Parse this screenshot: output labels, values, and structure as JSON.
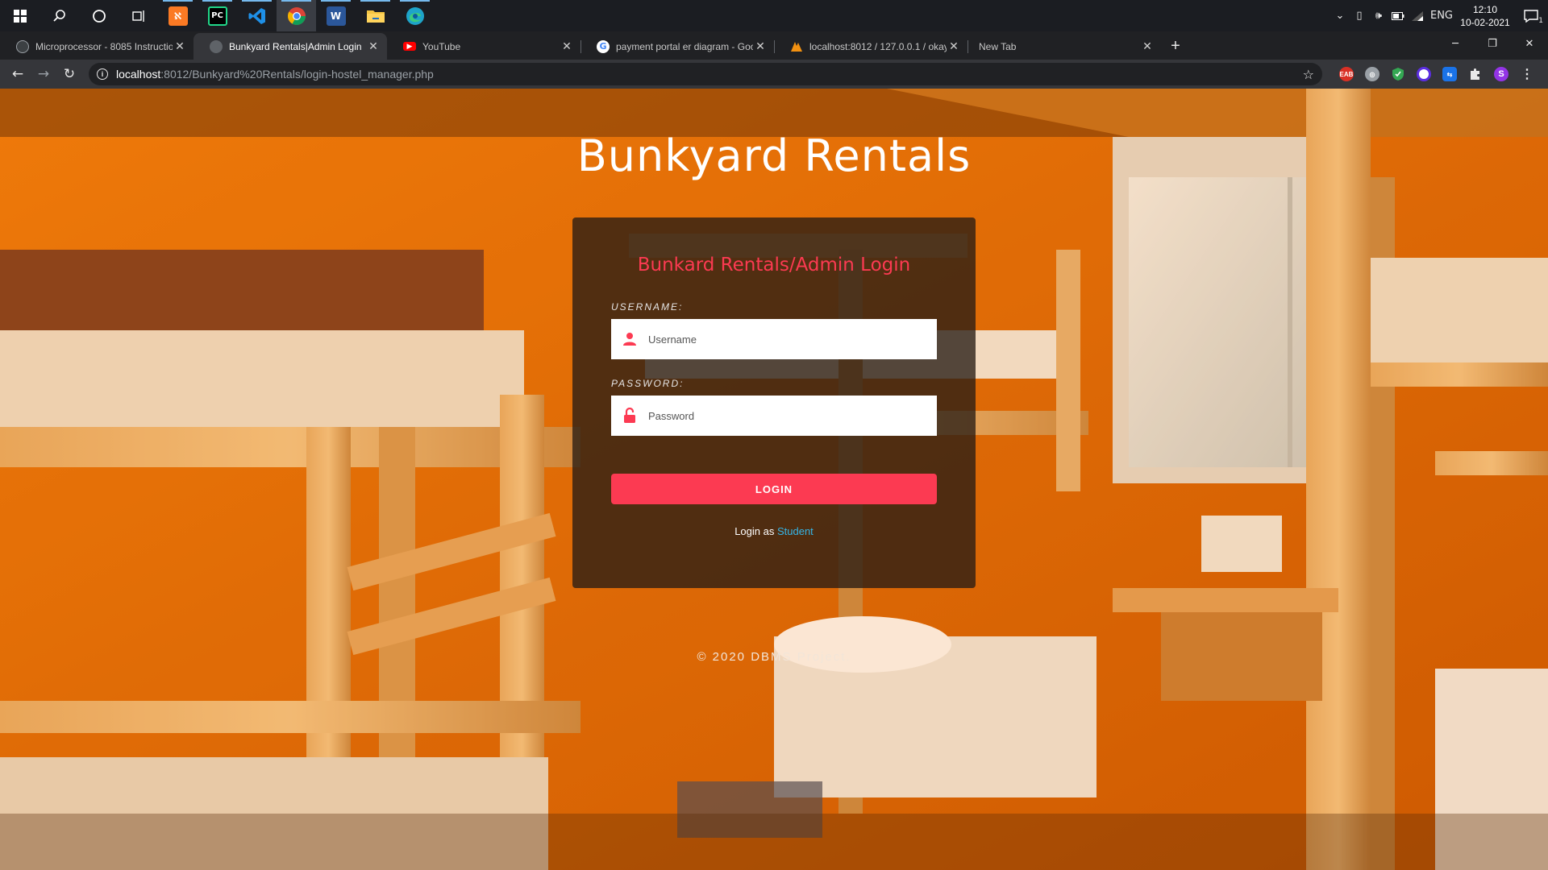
{
  "taskbar": {
    "apps": [
      {
        "name": "start",
        "icon": "windows-logo-icon"
      },
      {
        "name": "search",
        "icon": "search-icon"
      },
      {
        "name": "cortana",
        "icon": "cortana-circle-icon"
      },
      {
        "name": "task-view",
        "icon": "task-view-icon"
      },
      {
        "name": "xampp",
        "icon": "xampp-icon",
        "glyph": "Ƨ",
        "color": "#fb7a24"
      },
      {
        "name": "pycharm",
        "icon": "pycharm-icon",
        "glyph": "PC",
        "color": "#21d789"
      },
      {
        "name": "vscode",
        "icon": "vscode-icon",
        "glyph": "❰❱",
        "color": "#0078d4"
      },
      {
        "name": "chrome",
        "icon": "chrome-icon"
      },
      {
        "name": "word",
        "icon": "word-icon",
        "glyph": "W",
        "color": "#2b579a"
      },
      {
        "name": "file-explorer",
        "icon": "folder-icon",
        "glyph": "",
        "color": "#f4c542"
      },
      {
        "name": "edge",
        "icon": "edge-icon",
        "glyph": "e",
        "color": "#1ea4c9"
      }
    ],
    "tray": {
      "language": "ENG",
      "time": "12:10",
      "date": "10-02-2021",
      "notifications_count": "1"
    }
  },
  "browser": {
    "tabs": [
      {
        "title": "Microprocessor - 8085 Instructio",
        "favicon": "#8ab4f8"
      },
      {
        "title": "Bunkyard Rentals|Admin Login",
        "favicon": "#5f6368",
        "active": true
      },
      {
        "title": "YouTube",
        "favicon": "#ff0000"
      },
      {
        "title": "payment portal er diagram - Goo",
        "favicon": "#4285f4"
      },
      {
        "title": "localhost:8012 / 127.0.0.1 / okay",
        "favicon": "#f29111"
      },
      {
        "title": "New Tab",
        "favicon": ""
      }
    ],
    "url_host": "localhost",
    "url_path": ":8012/Bunkyard%20Rentals/login-hostel_manager.php",
    "profile_initial": "S"
  },
  "page": {
    "site_title": "Bunkyard Rentals",
    "login_heading": "Bunkard Rentals/Admin Login",
    "username_label": "USERNAME:",
    "username_placeholder": "Username",
    "password_label": "PASSWORD:",
    "password_placeholder": "Password",
    "login_button": "LOGIN",
    "alt_login_prefix": "Login as",
    "alt_login_link": "Student",
    "footer": "© 2020 DBMS Project.",
    "accent_color": "#fc3a52",
    "link_color": "#35b6e8"
  }
}
